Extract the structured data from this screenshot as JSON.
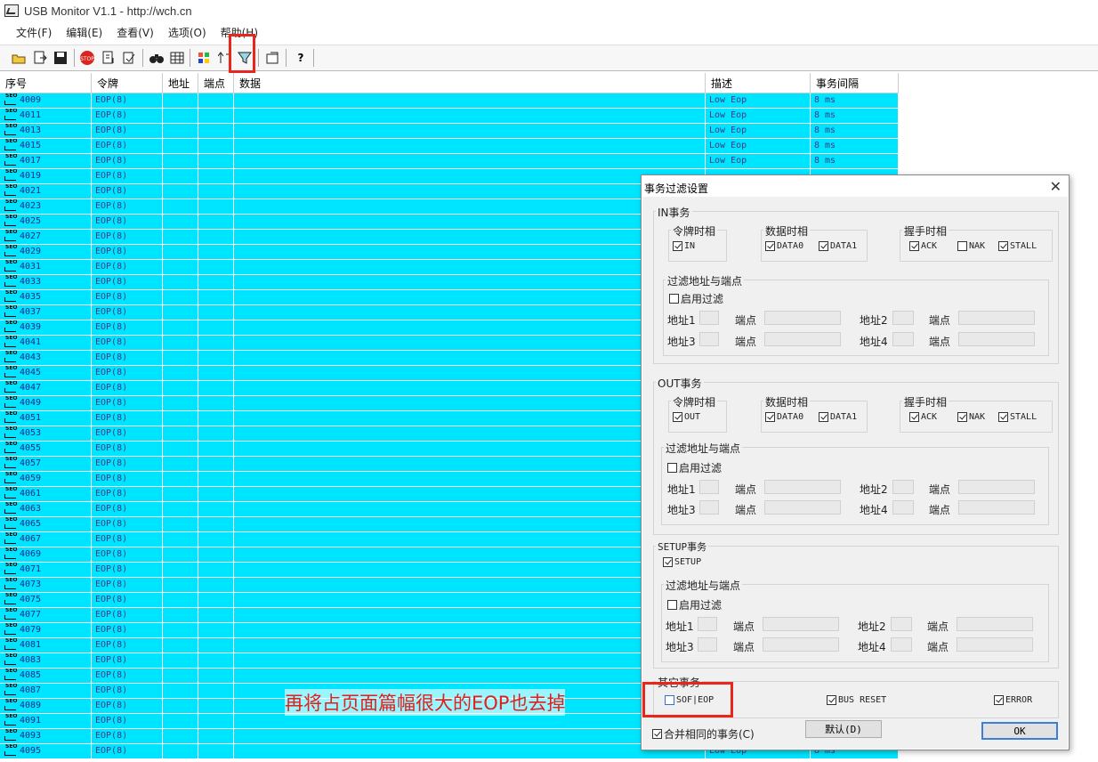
{
  "window": {
    "title": "USB Monitor V1.1 - http://wch.cn"
  },
  "menu": [
    "文件(F)",
    "编辑(E)",
    "查看(V)",
    "选项(O)",
    "帮助(H)"
  ],
  "toolbar": {
    "icons": [
      "open-folder-icon",
      "export-icon",
      "save-icon",
      "stop-icon",
      "capture-icon",
      "edit-icon",
      "find-icon",
      "table-icon",
      "color-icon",
      "sort-icon",
      "filter-icon",
      "settings-icon",
      "help-icon"
    ]
  },
  "grid": {
    "columns": [
      "序号",
      "令牌",
      "地址",
      "端点",
      "数据",
      "描述",
      "事务间隔"
    ],
    "rows": [
      {
        "seq": "4009",
        "token": "EOP(8)",
        "desc": "Low Eop",
        "interval": "8 ms"
      },
      {
        "seq": "4011",
        "token": "EOP(8)",
        "desc": "Low Eop",
        "interval": "8 ms"
      },
      {
        "seq": "4013",
        "token": "EOP(8)",
        "desc": "Low Eop",
        "interval": "8 ms"
      },
      {
        "seq": "4015",
        "token": "EOP(8)",
        "desc": "Low Eop",
        "interval": "8 ms"
      },
      {
        "seq": "4017",
        "token": "EOP(8)",
        "desc": "Low Eop",
        "interval": "8 ms"
      },
      {
        "seq": "4019",
        "token": "EOP(8)",
        "desc": "",
        "interval": ""
      },
      {
        "seq": "4021",
        "token": "EOP(8)",
        "desc": "",
        "interval": ""
      },
      {
        "seq": "4023",
        "token": "EOP(8)",
        "desc": "",
        "interval": ""
      },
      {
        "seq": "4025",
        "token": "EOP(8)",
        "desc": "",
        "interval": ""
      },
      {
        "seq": "4027",
        "token": "EOP(8)",
        "desc": "",
        "interval": ""
      },
      {
        "seq": "4029",
        "token": "EOP(8)",
        "desc": "",
        "interval": ""
      },
      {
        "seq": "4031",
        "token": "EOP(8)",
        "desc": "",
        "interval": ""
      },
      {
        "seq": "4033",
        "token": "EOP(8)",
        "desc": "",
        "interval": ""
      },
      {
        "seq": "4035",
        "token": "EOP(8)",
        "desc": "",
        "interval": ""
      },
      {
        "seq": "4037",
        "token": "EOP(8)",
        "desc": "",
        "interval": ""
      },
      {
        "seq": "4039",
        "token": "EOP(8)",
        "desc": "",
        "interval": ""
      },
      {
        "seq": "4041",
        "token": "EOP(8)",
        "desc": "",
        "interval": ""
      },
      {
        "seq": "4043",
        "token": "EOP(8)",
        "desc": "",
        "interval": ""
      },
      {
        "seq": "4045",
        "token": "EOP(8)",
        "desc": "",
        "interval": ""
      },
      {
        "seq": "4047",
        "token": "EOP(8)",
        "desc": "",
        "interval": ""
      },
      {
        "seq": "4049",
        "token": "EOP(8)",
        "desc": "",
        "interval": ""
      },
      {
        "seq": "4051",
        "token": "EOP(8)",
        "desc": "",
        "interval": ""
      },
      {
        "seq": "4053",
        "token": "EOP(8)",
        "desc": "",
        "interval": ""
      },
      {
        "seq": "4055",
        "token": "EOP(8)",
        "desc": "",
        "interval": ""
      },
      {
        "seq": "4057",
        "token": "EOP(8)",
        "desc": "",
        "interval": ""
      },
      {
        "seq": "4059",
        "token": "EOP(8)",
        "desc": "",
        "interval": ""
      },
      {
        "seq": "4061",
        "token": "EOP(8)",
        "desc": "",
        "interval": ""
      },
      {
        "seq": "4063",
        "token": "EOP(8)",
        "desc": "",
        "interval": ""
      },
      {
        "seq": "4065",
        "token": "EOP(8)",
        "desc": "",
        "interval": ""
      },
      {
        "seq": "4067",
        "token": "EOP(8)",
        "desc": "",
        "interval": ""
      },
      {
        "seq": "4069",
        "token": "EOP(8)",
        "desc": "",
        "interval": ""
      },
      {
        "seq": "4071",
        "token": "EOP(8)",
        "desc": "",
        "interval": ""
      },
      {
        "seq": "4073",
        "token": "EOP(8)",
        "desc": "",
        "interval": ""
      },
      {
        "seq": "4075",
        "token": "EOP(8)",
        "desc": "",
        "interval": ""
      },
      {
        "seq": "4077",
        "token": "EOP(8)",
        "desc": "",
        "interval": ""
      },
      {
        "seq": "4079",
        "token": "EOP(8)",
        "desc": "",
        "interval": ""
      },
      {
        "seq": "4081",
        "token": "EOP(8)",
        "desc": "",
        "interval": ""
      },
      {
        "seq": "4083",
        "token": "EOP(8)",
        "desc": "",
        "interval": ""
      },
      {
        "seq": "4085",
        "token": "EOP(8)",
        "desc": "",
        "interval": ""
      },
      {
        "seq": "4087",
        "token": "EOP(8)",
        "desc": "",
        "interval": ""
      },
      {
        "seq": "4089",
        "token": "EOP(8)",
        "desc": "",
        "interval": ""
      },
      {
        "seq": "4091",
        "token": "EOP(8)",
        "desc": "",
        "interval": ""
      },
      {
        "seq": "4093",
        "token": "EOP(8)",
        "desc": "",
        "interval": ""
      },
      {
        "seq": "4095",
        "token": "EOP(8)",
        "desc": "Low Eop",
        "interval": "8 ms"
      }
    ],
    "row_icon_text": "SEO"
  },
  "dialog": {
    "title": "事务过滤设置",
    "in": {
      "title": "IN事务",
      "token_title": "令牌时相",
      "token_check": "IN",
      "data_title": "数据时相",
      "data0": "DATA0",
      "data1": "DATA1",
      "hs_title": "握手时相",
      "ack": "ACK",
      "nak": "NAK",
      "stall": "STALL",
      "filter_title": "过滤地址与端点",
      "enable": "启用过滤",
      "addr1": "地址1",
      "addr2": "地址2",
      "addr3": "地址3",
      "addr4": "地址4",
      "ep": "端点"
    },
    "out": {
      "title": "OUT事务",
      "token_title": "令牌时相",
      "token_check": "OUT",
      "data_title": "数据时相",
      "data0": "DATA0",
      "data1": "DATA1",
      "hs_title": "握手时相",
      "ack": "ACK",
      "nak": "NAK",
      "stall": "STALL",
      "filter_title": "过滤地址与端点",
      "enable": "启用过滤",
      "addr1": "地址1",
      "addr2": "地址2",
      "addr3": "地址3",
      "addr4": "地址4",
      "ep": "端点"
    },
    "setup": {
      "title": "SETUP事务",
      "check": "SETUP",
      "filter_title": "过滤地址与端点",
      "enable": "启用过滤",
      "addr1": "地址1",
      "addr2": "地址2",
      "addr3": "地址3",
      "addr4": "地址4",
      "ep": "端点"
    },
    "other": {
      "title": "其它事务",
      "sof": "SOF|EOP",
      "bus_reset": "BUS RESET",
      "error": "ERROR"
    },
    "merge": "合并相同的事务(C)",
    "default_btn": "默认(D)",
    "ok_btn": "OK"
  },
  "annotation": "再将占页面篇幅很大的EOP也去掉"
}
